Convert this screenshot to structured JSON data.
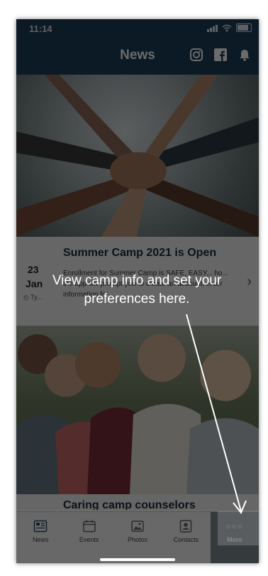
{
  "status_bar": {
    "time": "11:14"
  },
  "nav": {
    "title": "News",
    "icons": [
      "instagram-icon",
      "facebook-icon",
      "bell-icon"
    ]
  },
  "news": [
    {
      "title": "Summer Camp 2021 is Open",
      "day": "23",
      "month": "Jan",
      "ago": "Ty...",
      "excerpt": "Enrollment for Summer Camp is SAFE, EASY... ho... the app will prompt you to create an account, enter information for ..."
    },
    {
      "title": "Caring camp counselors"
    }
  ],
  "hint": {
    "text": "View camp info and set your preferences here."
  },
  "tabs": [
    {
      "label": "News",
      "icon": "news-icon"
    },
    {
      "label": "Events",
      "icon": "calendar-icon"
    },
    {
      "label": "Photos",
      "icon": "photos-icon"
    },
    {
      "label": "Contacts",
      "icon": "contacts-icon"
    },
    {
      "label": "More",
      "icon": "more-dots-icon",
      "dots": "○○○"
    }
  ],
  "colors": {
    "nav_bg": "#1e3f5c",
    "tab_active": "#7e8a90",
    "overlay": "rgba(0,0,0,0.58)"
  }
}
